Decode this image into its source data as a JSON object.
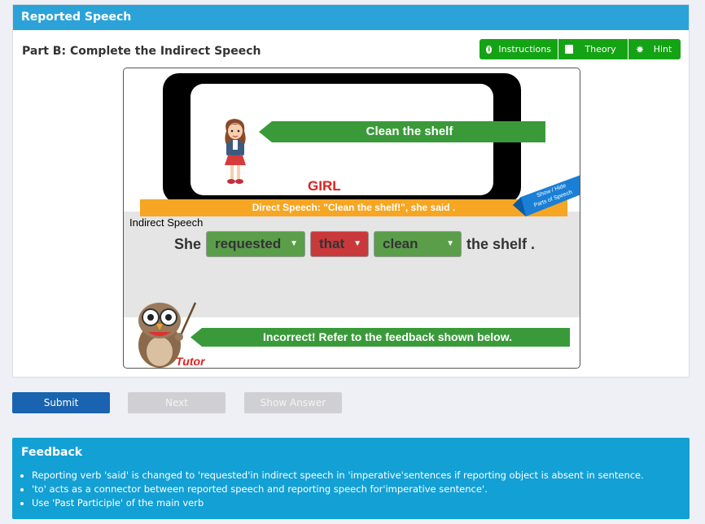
{
  "panel": {
    "title": "Reported Speech",
    "part_title": "Part B: Complete the Indirect Speech",
    "buttons": [
      {
        "label": "Instructions",
        "icon": "info-icon"
      },
      {
        "label": "Theory",
        "icon": "book-icon"
      },
      {
        "label": "Hint",
        "icon": "gear-icon"
      }
    ]
  },
  "activity": {
    "speech_bubble": "Clean the shelf",
    "speaker_label": "GIRL",
    "direct_speech": "Direct Speech:   \"Clean  the shelf!\", she said .",
    "parts_flag": "Show / Hide\nParts of Speech",
    "indirect_label": "Indirect Speech",
    "sentence": {
      "start": "She",
      "dropdowns": [
        {
          "value": "requested",
          "state": "correct"
        },
        {
          "value": "that",
          "state": "incorrect"
        },
        {
          "value": "clean",
          "state": "correct"
        }
      ],
      "end": "the shelf ."
    },
    "tutor_label": "Tutor",
    "tutor_feedback": "Incorrect! Refer to the feedback shown below."
  },
  "actions": {
    "submit": "Submit",
    "next": "Next",
    "show_answer": "Show Answer"
  },
  "feedback": {
    "title": "Feedback",
    "items": [
      "Reporting verb 'said' is changed to 'requested'in indirect speech in 'imperative'sentences if reporting object is absent in sentence.",
      "'to' acts as a connector between reported speech and reporting speech for'imperative sentence'.",
      "Use 'Past Participle' of the main verb"
    ]
  },
  "colors": {
    "header_blue": "#2ba3d8",
    "button_green": "#14a314",
    "arrow_green": "#3a9a3a",
    "direct_orange": "#f6a623",
    "incorrect_red": "#c9393b",
    "submit_blue": "#1a63b0",
    "feedback_blue": "#13a0d5"
  }
}
